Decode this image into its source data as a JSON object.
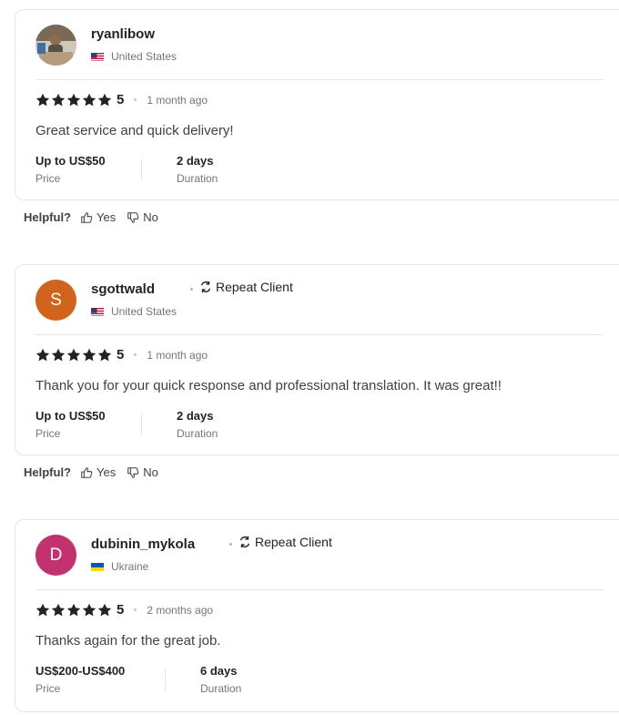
{
  "reviews": [
    {
      "username": "ryanlibow",
      "avatar_letter": "",
      "avatar_type": "photo",
      "avatar_color": "#c9c2b5",
      "repeat_client": false,
      "repeat_label": "",
      "country": "United States",
      "flag": "us-flag",
      "rating": "5",
      "time_ago": "1 month ago",
      "text": "Great service and quick delivery!",
      "price_value": "Up to US$50",
      "price_label": "Price",
      "duration_value": "2 days",
      "duration_label": "Duration"
    },
    {
      "username": "sgottwald",
      "avatar_letter": "S",
      "avatar_type": "letter",
      "avatar_color": "#d0641b",
      "repeat_client": true,
      "repeat_label": "Repeat Client",
      "country": "United States",
      "flag": "us-flag",
      "rating": "5",
      "time_ago": "1 month ago",
      "text": "Thank you for your quick response and professional translation. It was great!!",
      "price_value": "Up to US$50",
      "price_label": "Price",
      "duration_value": "2 days",
      "duration_label": "Duration"
    },
    {
      "username": "dubinin_mykola",
      "avatar_letter": "D",
      "avatar_type": "letter",
      "avatar_color": "#c2326e",
      "repeat_client": true,
      "repeat_label": "Repeat Client",
      "country": "Ukraine",
      "flag": "ukraine-flag",
      "rating": "5",
      "time_ago": "2 months ago",
      "text": "Thanks again for the great job.",
      "price_value": "US$200-US$400",
      "price_label": "Price",
      "duration_value": "6 days",
      "duration_label": "Duration"
    }
  ],
  "helpful": {
    "label": "Helpful?",
    "yes": "Yes",
    "no": "No"
  },
  "colors": {
    "star": "#222325",
    "text": "#404145",
    "muted": "#74767e",
    "border": "#e4e5e7"
  }
}
